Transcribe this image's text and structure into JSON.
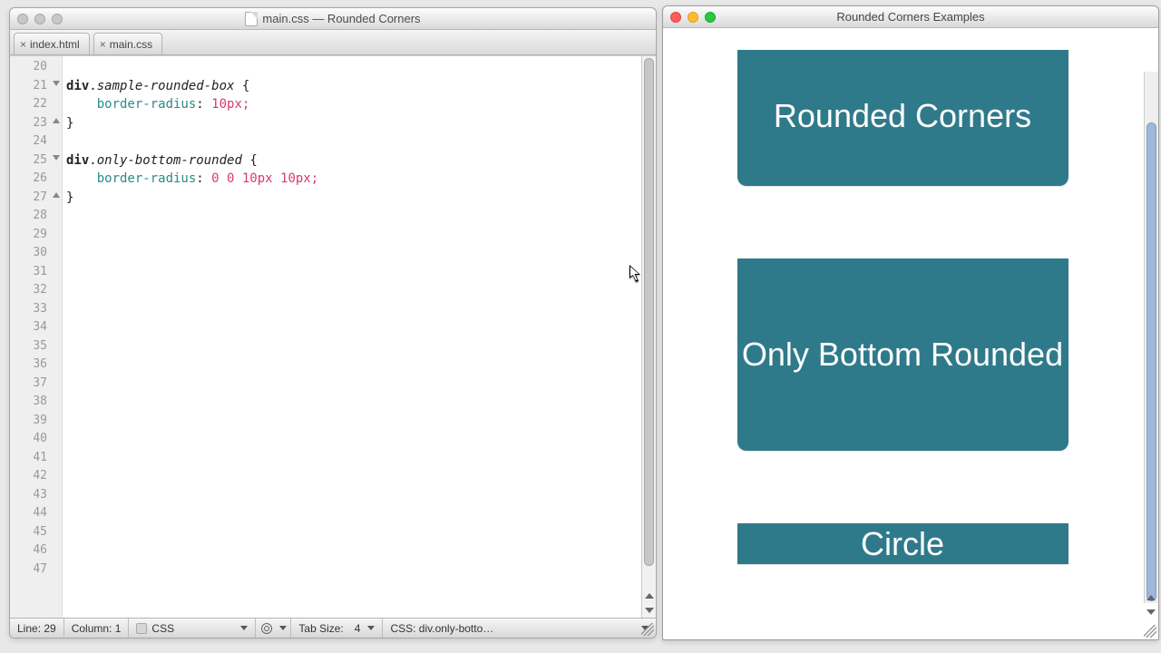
{
  "editor_window": {
    "title": "main.css — Rounded Corners",
    "tabs": [
      {
        "label": "index.html"
      },
      {
        "label": "main.css"
      }
    ],
    "first_line_number": 20,
    "line_count": 28,
    "fold_markers": {
      "21": "open",
      "23": "close",
      "25": "open",
      "27": "close"
    },
    "code_lines": {
      "20": {
        "raw": ""
      },
      "21": {
        "kw": "div",
        "dot": ".",
        "sel": "sample-rounded-box",
        "tail": " {"
      },
      "22": {
        "indent": "    ",
        "prop": "border-radius",
        "colon": ": ",
        "val": "10px",
        "semi": ";"
      },
      "23": {
        "raw": "}"
      },
      "24": {
        "raw": ""
      },
      "25": {
        "kw": "div",
        "dot": ".",
        "sel": "only-bottom-rounded",
        "tail": " {"
      },
      "26": {
        "indent": "    ",
        "prop": "border-radius",
        "colon": ": ",
        "val": "0 0 10px 10px",
        "semi": ";"
      },
      "27": {
        "raw": "}"
      },
      "28": {
        "raw": ""
      }
    },
    "statusbar": {
      "line_label": "Line: 29",
      "column_label": "Column: 1",
      "language": "CSS",
      "tab_size_label": "Tab Size:",
      "tab_size_value": "4",
      "scope": "CSS: div.only-botto…"
    },
    "cursor_line": 29,
    "cursor_column": 1
  },
  "browser_window": {
    "title": "Rounded Corners Examples",
    "cards": [
      {
        "text": "Rounded Corners"
      },
      {
        "text": "Only Bottom Rounded"
      },
      {
        "text": "Circle"
      }
    ]
  }
}
